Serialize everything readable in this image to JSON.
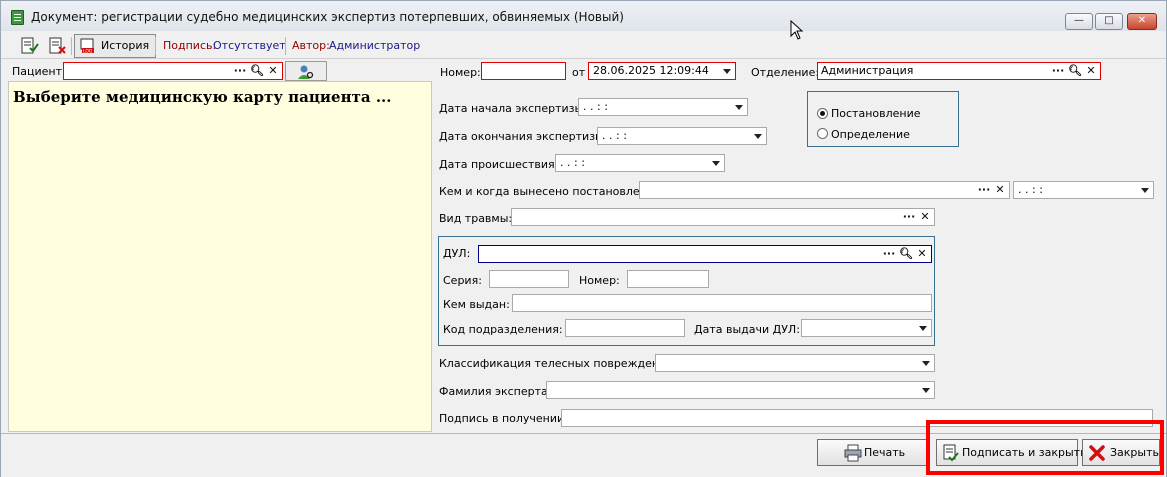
{
  "window": {
    "title": "Документ: регистрации судебно медицинских экспертиз потерпевших, обвиняемых (Новый)",
    "controls": {
      "minimize": "—",
      "maximize": "□",
      "close": "✕"
    }
  },
  "toolbar": {
    "history_label": "История",
    "sign_label": "Подпись:",
    "sign_value": "Отсутствует",
    "author_label": "Автор:",
    "author_value": "Администратор"
  },
  "header": {
    "patient_label": "Пациент:",
    "patient_value": "",
    "number_label": "Номер:",
    "number_value": "",
    "from_label": "от",
    "date_value": "28.06.2025 12:09:44",
    "department_label": "Отделение:",
    "department_value": "Администрация"
  },
  "patient_panel": {
    "message": "Выберите медицинскую карту пациента ..."
  },
  "form": {
    "exam_start_label": "Дата начала экспертизы:",
    "exam_start_value": ".  .      :  :",
    "exam_end_label": "Дата окончания экспертизы:",
    "exam_end_value": ".  .      :  :",
    "incident_label": "Дата происшествия:",
    "incident_value": ".  .      :  :",
    "issued_by_label": "Кем и когда вынесено постановление:",
    "issued_by_value": "",
    "issued_date_value": ".  .      :  :",
    "injury_type_label": "Вид травмы:",
    "injury_type_value": "",
    "decision_options": [
      "Постановление",
      "Определение"
    ],
    "decision_selected": "Постановление",
    "classification_label": "Классификация телесных повреждений:",
    "classification_value": "",
    "expert_label": "Фамилия эксперта:",
    "expert_value": "",
    "signature_label": "Подпись в получении:",
    "signature_value": ""
  },
  "dul": {
    "label": "ДУЛ:",
    "value": "",
    "series_label": "Серия:",
    "series_value": "",
    "number_label": "Номер:",
    "number_value": "",
    "issued_by_label": "Кем выдан:",
    "issued_by_value": "",
    "subdivision_label": "Код подразделения:",
    "subdivision_value": "",
    "issue_date_label": "Дата выдачи ДУЛ:",
    "issue_date_value": ""
  },
  "buttons": {
    "print": "Печать",
    "sign_close": "Подписать и закрыть",
    "close": "Закрыть"
  },
  "colors": {
    "required_border": "#e00000",
    "patient_panel_bg": "#ffffe0",
    "highlight": "#ff0000",
    "link_text": "#1a1a8c"
  }
}
